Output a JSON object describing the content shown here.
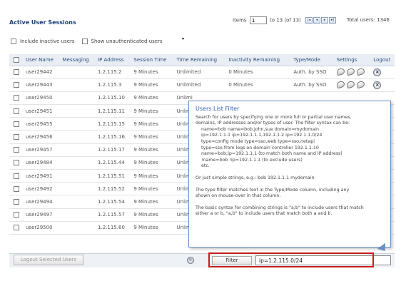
{
  "page": {
    "title": "Active User Sessions",
    "items_label": "Items",
    "items_from": "1",
    "items_range": "to 13 (of 13)",
    "total_label": "Total users: 1346",
    "pager_icons": [
      "first-page-icon",
      "prev-page-icon",
      "next-page-icon",
      "last-page-icon"
    ]
  },
  "options": {
    "include_inactive": "Include inactive users",
    "show_unauth": "Show unauthenticated users"
  },
  "table": {
    "headers": [
      "User Name",
      "Messaging",
      "IP Address",
      "Session Time",
      "Time Remaining",
      "Inactivity Remaining",
      "Type/Mode",
      "Settings",
      "Logout"
    ],
    "rows": [
      {
        "user": "user29442",
        "ip": "1.2.115.2",
        "session": "9 Minutes",
        "remaining": "Unlimited",
        "inactivity": "0 Minutes",
        "type": "Auth. by SSO"
      },
      {
        "user": "user29443",
        "ip": "1.2.115.3",
        "session": "9 Minutes",
        "remaining": "Unlimited",
        "inactivity": "0 Minutes",
        "type": "Auth. by SSO"
      },
      {
        "user": "user29450",
        "ip": "1.2.115.10",
        "session": "9 Minutes",
        "remaining": "Unlimi",
        "inactivity": "",
        "type": ""
      },
      {
        "user": "user29451",
        "ip": "1.2.115.11",
        "session": "9 Minutes",
        "remaining": "Unlimi",
        "inactivity": "",
        "type": ""
      },
      {
        "user": "user29455",
        "ip": "1.2.115.15",
        "session": "9 Minutes",
        "remaining": "Unlimi",
        "inactivity": "",
        "type": ""
      },
      {
        "user": "user29456",
        "ip": "1.2.115.16",
        "session": "9 Minutes",
        "remaining": "Unlimi",
        "inactivity": "",
        "type": ""
      },
      {
        "user": "user29457",
        "ip": "1.2.115.17",
        "session": "9 Minutes",
        "remaining": "Unlimi",
        "inactivity": "",
        "type": ""
      },
      {
        "user": "user29484",
        "ip": "1.2.115.44",
        "session": "9 Minutes",
        "remaining": "Unlimi",
        "inactivity": "",
        "type": ""
      },
      {
        "user": "user29491",
        "ip": "1.2.115.51",
        "session": "9 Minutes",
        "remaining": "Unlimi",
        "inactivity": "",
        "type": ""
      },
      {
        "user": "user29492",
        "ip": "1.2.115.52",
        "session": "9 Minutes",
        "remaining": "Unlimi",
        "inactivity": "",
        "type": ""
      },
      {
        "user": "user29494",
        "ip": "1.2.115.54",
        "session": "9 Minutes",
        "remaining": "Unlimi",
        "inactivity": "",
        "type": ""
      },
      {
        "user": "user29497",
        "ip": "1.2.115.57",
        "session": "9 Minutes",
        "remaining": "Unlimi",
        "inactivity": "",
        "type": ""
      },
      {
        "user": "user29500",
        "ip": "1.2.115.60",
        "session": "9 Minutes",
        "remaining": "Unlimi",
        "inactivity": "",
        "type": ""
      }
    ]
  },
  "bottom": {
    "logout_selected": "Logout Selected Users",
    "filter_button": "Filter",
    "filter_value": "ip=1.2.115.0/24"
  },
  "tooltip": {
    "title": "Users List Filter",
    "lines": [
      "Search for users by specifying one or more full or partial user names,",
      "domains, IP addresses and/or types of user. The filter syntax can be:",
      "name=bob  name=bob,john,sue  domain=mydomain",
      "ip=192.1.1.1  ip=192.1.1.1,192.1.1.2  ip=192.1.1.0/24",
      "type=config mode  type=sso,web  type=sso,netapi",
      "type=sso;from logs on domain controller 192.1.1.10",
      "name=bob;ip=192.1.1.1      (to match both name and IP address)",
      "!name=bob  !ip=192.1.1.1    (to exclude users)",
      "etc.",
      "Or just simple strings, e.g.:  bob   192.1.1.1   mydomain",
      "The type filter matches text in the Type/Mode column, including any",
      "shown on mouse-over in that column.",
      "The basic syntax for combining strings is \"a;b\" to include users that match",
      "either a or b, \"a,b\" to include users that match both a and b."
    ]
  },
  "colors": {
    "title": "#1c3f7a",
    "header_bg": "#e9eef5",
    "tooltip_border": "#6a8fc5",
    "tooltip_title": "#2f62b3",
    "highlight": "#c41e1e"
  }
}
